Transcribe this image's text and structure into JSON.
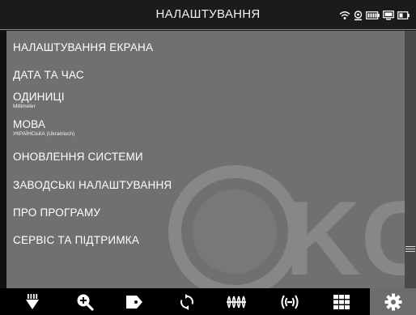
{
  "header": {
    "title": "НАЛАШТУВАННЯ",
    "status_icons": [
      "wifi-icon",
      "location-icon",
      "battery-icon",
      "monitor-icon",
      "link-battery-icon"
    ]
  },
  "menu": {
    "items": [
      {
        "label": "НАЛАШТУВАННЯ ЕКРАНА",
        "sub": ""
      },
      {
        "label": "ДАТА ТА ЧАС",
        "sub": ""
      },
      {
        "label": "ОДИНИЦІ",
        "sub": "Millimeter"
      },
      {
        "label": "МОВА",
        "sub": "УКРАЇНСЬКА (Ukrainisch)"
      },
      {
        "label": "ОНОВЛЕННЯ СИСТЕМИ",
        "sub": ""
      },
      {
        "label": "ЗАВОДСЬКІ НАЛАШТУВАННЯ",
        "sub": ""
      },
      {
        "label": "ПРО ПРОГРАМУ",
        "sub": ""
      },
      {
        "label": "СЕРВІС ТА ПІДТРИМКА",
        "sub": ""
      }
    ]
  },
  "watermark": {
    "text": "KC"
  },
  "toolbar": {
    "items": [
      {
        "icon": "light-icon"
      },
      {
        "icon": "zoom-in-icon"
      },
      {
        "icon": "tag-icon"
      },
      {
        "icon": "rotate-icon"
      },
      {
        "icon": "cable-icon"
      },
      {
        "icon": "signal-icon"
      },
      {
        "icon": "grid-icon"
      },
      {
        "icon": "gear-icon",
        "active": true
      }
    ]
  },
  "colors": {
    "panel": "#707070",
    "header": "#1b1b1b",
    "toolbar": "#000000",
    "active_tool": "#6c6c6c"
  }
}
